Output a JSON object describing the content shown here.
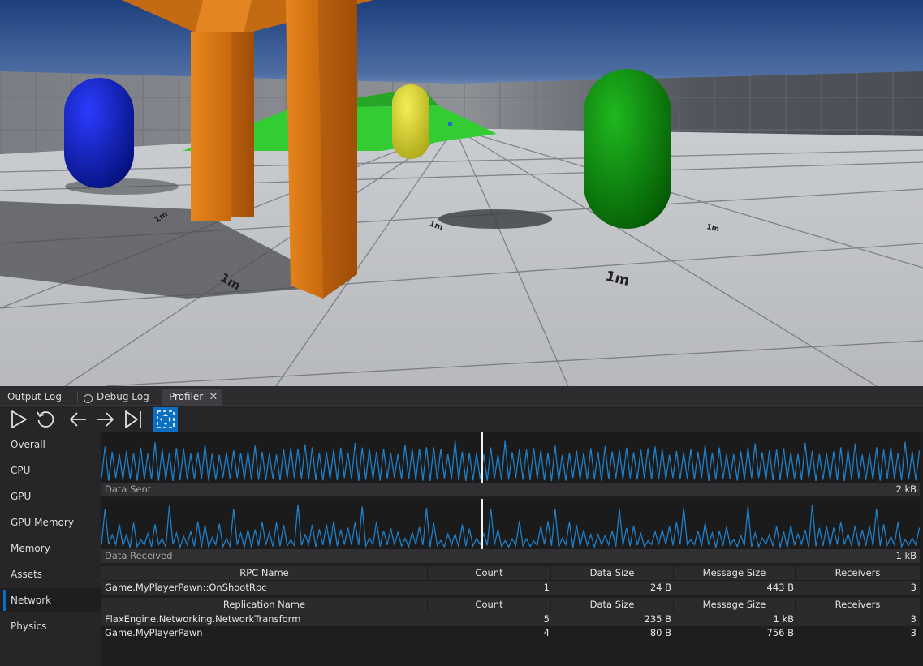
{
  "tabs": [
    {
      "label": "Output Log",
      "icon": null
    },
    {
      "label": "Debug Log",
      "icon": "info-icon"
    },
    {
      "label": "Profiler",
      "icon": null,
      "active": true
    }
  ],
  "toolbar": {
    "buttons": [
      "play-icon",
      "reset-icon",
      "arrow-left-icon",
      "arrow-right-icon",
      "skip-to-last-icon",
      "live-recording-icon"
    ],
    "active_button": "live-recording-icon"
  },
  "sidebar": {
    "items": [
      "Overall",
      "CPU",
      "GPU",
      "GPU Memory",
      "Memory",
      "Assets",
      "Network",
      "Physics"
    ],
    "selected": "Network"
  },
  "graphs": {
    "sent": {
      "label": "Data Sent",
      "max": "2 kB"
    },
    "received": {
      "label": "Data Received",
      "max": "1 kB"
    }
  },
  "rpc_table": {
    "columns": [
      "RPC Name",
      "Count",
      "Data Size",
      "Message Size",
      "Receivers"
    ],
    "rows": [
      [
        "Game.MyPlayerPawn::OnShootRpc",
        "1",
        "24 B",
        "443 B",
        "3"
      ]
    ]
  },
  "replication_table": {
    "columns": [
      "Replication Name",
      "Count",
      "Data Size",
      "Message Size",
      "Receivers"
    ],
    "rows": [
      [
        "FlaxEngine.Networking.NetworkTransform",
        "5",
        "235 B",
        "1 kB",
        "3"
      ],
      [
        "Game.MyPlayerPawn",
        "4",
        "80 B",
        "756 B",
        "3"
      ]
    ]
  },
  "scene": {
    "floor_labels": [
      "1m",
      "1m",
      "1m",
      "1m",
      "1m"
    ]
  },
  "colors": {
    "accent": "#0a6fc2",
    "graph_line": "#1f7fc9"
  }
}
